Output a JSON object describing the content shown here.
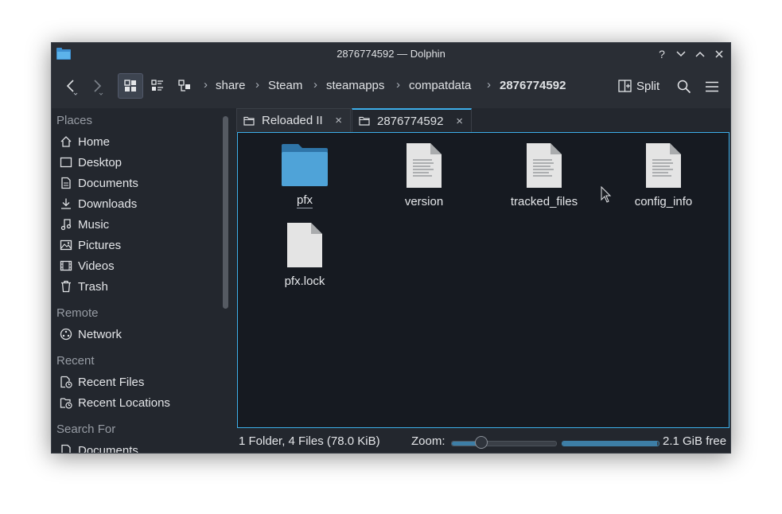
{
  "window": {
    "title": "2876774592 — Dolphin"
  },
  "titlebar_buttons": {
    "help": "?",
    "minimize": "⌄",
    "maximize": "⌃",
    "close": "✕"
  },
  "breadcrumb": {
    "segments": [
      "share",
      "Steam",
      "steamapps",
      "compatdata"
    ],
    "current": "2876774592"
  },
  "toolbar": {
    "split_label": "Split"
  },
  "sidebar": {
    "places_heading": "Places",
    "places": [
      {
        "label": "Home",
        "icon": "home-icon"
      },
      {
        "label": "Desktop",
        "icon": "desktop-icon"
      },
      {
        "label": "Documents",
        "icon": "documents-icon"
      },
      {
        "label": "Downloads",
        "icon": "downloads-icon"
      },
      {
        "label": "Music",
        "icon": "music-icon"
      },
      {
        "label": "Pictures",
        "icon": "pictures-icon"
      },
      {
        "label": "Videos",
        "icon": "videos-icon"
      },
      {
        "label": "Trash",
        "icon": "trash-icon"
      }
    ],
    "remote_heading": "Remote",
    "remote": [
      {
        "label": "Network",
        "icon": "network-icon"
      }
    ],
    "recent_heading": "Recent",
    "recent": [
      {
        "label": "Recent Files",
        "icon": "recent-files-icon"
      },
      {
        "label": "Recent Locations",
        "icon": "recent-locations-icon"
      }
    ],
    "search_heading": "Search For",
    "search": [
      {
        "label": "Documents",
        "icon": "documents-icon"
      }
    ]
  },
  "tabs": [
    {
      "label": "Reloaded II",
      "active": false
    },
    {
      "label": "2876774592",
      "active": true
    }
  ],
  "files": [
    {
      "name": "pfx",
      "type": "folder"
    },
    {
      "name": "version",
      "type": "text-file"
    },
    {
      "name": "tracked_files",
      "type": "text-file"
    },
    {
      "name": "config_info",
      "type": "text-file"
    },
    {
      "name": "pfx.lock",
      "type": "blank-file"
    }
  ],
  "statusbar": {
    "summary": "1 Folder, 4 Files (78.0 KiB)",
    "zoom_label": "Zoom:",
    "zoom_level": 0.28,
    "space_used_fraction": 0.98,
    "free_space": "2.1 GiB free"
  },
  "colors": {
    "accent": "#3daee9",
    "folder": "#4fa3d8",
    "window_bg": "#23272e",
    "content_bg": "#161a21"
  }
}
